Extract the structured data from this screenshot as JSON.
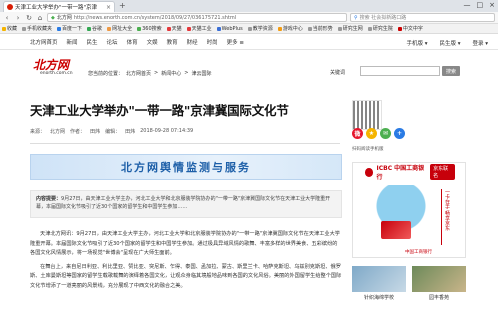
{
  "browser": {
    "tab_title": "天津工业大学举办\"一带一路\"京津",
    "tab_close": "×",
    "new_tab": "+",
    "window_buttons": [
      "—",
      "□",
      "×"
    ],
    "nav": {
      "back": "‹",
      "forward": "›",
      "refresh": "↻",
      "home": "⌂"
    },
    "address": {
      "site": "北方网",
      "url": "http://news.enorth.com.cn/system/2018/09/27/036175721.shtml"
    },
    "search": {
      "placeholder": "搜索 社会拟新路口路"
    },
    "bookmarks": [
      "收藏",
      "手机收藏夹",
      "百度一下",
      "谷歌",
      "网址大全",
      "360搜索",
      "天猫",
      "天猫工业",
      "WebPlus",
      "教学资源",
      "游戏中心",
      "当前形势",
      "研究生网",
      "研究生院",
      "中文中字"
    ]
  },
  "site_nav": {
    "items": [
      "北方网首页",
      "新闻",
      "民生",
      "论坛",
      "体育",
      "文娱",
      "教育",
      "财经",
      "时尚",
      "更多 ≡"
    ],
    "right": [
      "手机版 ▾",
      "民生版 ▾",
      "登录 ▾"
    ]
  },
  "header": {
    "logo_cn": "北方网",
    "logo_en": "enorth.com.cn",
    "breadcrumb": [
      "您当前的位置：",
      "北方网首页",
      ">",
      "新闻中心",
      ">",
      "津云国际"
    ],
    "keyword_label": "关键词",
    "search_button": "搜索"
  },
  "article": {
    "headline": "天津工业大学举办\"一带一路\"京津冀国际文化节",
    "source_label": "来源：",
    "source": "北方网",
    "author_label": "作者：",
    "author": "田炜",
    "editor_label": "编辑：",
    "editor": "田炜",
    "datetime": "2018-09-28 07:14:39",
    "banner_text": "北方网舆情监测与服务",
    "summary_label": "内容提要：",
    "summary": "9月27日，由天津工业大学主办，河北工业大学和北京服装学院协办的\"一带一路\"京津冀国际文化节在天津工业大学隆重开幕，本届国际文化节吸引了近30个国家的留学生和中国学生参加……",
    "paragraphs": [
      "天津北方网讯：9月27日，由天津工业大学主办，河北工业大学和北京服装学院协办的\"一带一路\"京津冀国际文化节在天津工业大学隆重开幕。本届国际文化节吸引了近30个国家的留学生和中国学生参加。通过极具异域风情的歌舞、丰富多样的世界美食、五彩缤纷的各国文化风情展示，将一场视觉\"世博会\"呈现在广大师生面前。",
      "在舞台上，来自尼日利亚、利比里亚、赞比亚、突尼斯、乍得、泰国、孟加拉、蒙古、斯里兰卡、哈萨克斯坦、乌兹别克斯坦、俄罗斯、土库曼斯坦等国家的留学生载歌载舞的演绎着各国文化，让观众身临其境般地品味到各国的文化风俗。美丽的外国留学生给整个国际文化节增添了一道亮丽的风景线，充分展现了中西文化的融合之美。"
    ],
    "body_prefix": "天津北方网讯："
  },
  "sidebar": {
    "qr_label": "扫码阅读手机版",
    "share_icons": [
      "weibo",
      "qzone",
      "wechat",
      "more"
    ],
    "ad": {
      "brand": "ICBC 中国工商银行",
      "brand_short": "ICBC",
      "tag": "京东联名",
      "side_text": "一卡在手 畅享京东",
      "footer": "中国工商银行"
    },
    "thumbs": [
      {
        "caption": "针织海绵学校"
      },
      {
        "caption": "园丰香苑"
      }
    ]
  },
  "colors": {
    "accent_red": "#c7000b",
    "banner_blue": "#1d5fa8"
  }
}
